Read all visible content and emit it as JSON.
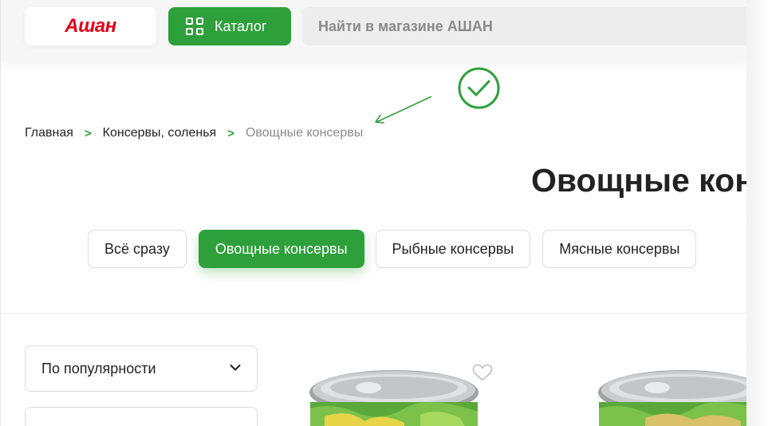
{
  "header": {
    "logo_text": "Ашан",
    "catalog_label": "Каталог",
    "search_placeholder": "Найти в магазине АШАН"
  },
  "breadcrumb": {
    "items": [
      "Главная",
      "Консервы, соленья",
      "Овощные консервы"
    ],
    "separator": ">"
  },
  "page": {
    "title": "Овощные консервы"
  },
  "categories": {
    "chips": [
      "Всё сразу",
      "Овощные консервы",
      "Рыбные консервы",
      "Мясные консервы"
    ],
    "active_index": 1
  },
  "sort": {
    "selected": "По популярности"
  },
  "colors": {
    "accent": "#2ea03b",
    "brand_red": "#e2001a"
  },
  "icons": [
    "grid-icon",
    "check-circle-icon",
    "arrow-icon",
    "chevron-right-icon",
    "chevron-down-icon",
    "heart-icon"
  ]
}
